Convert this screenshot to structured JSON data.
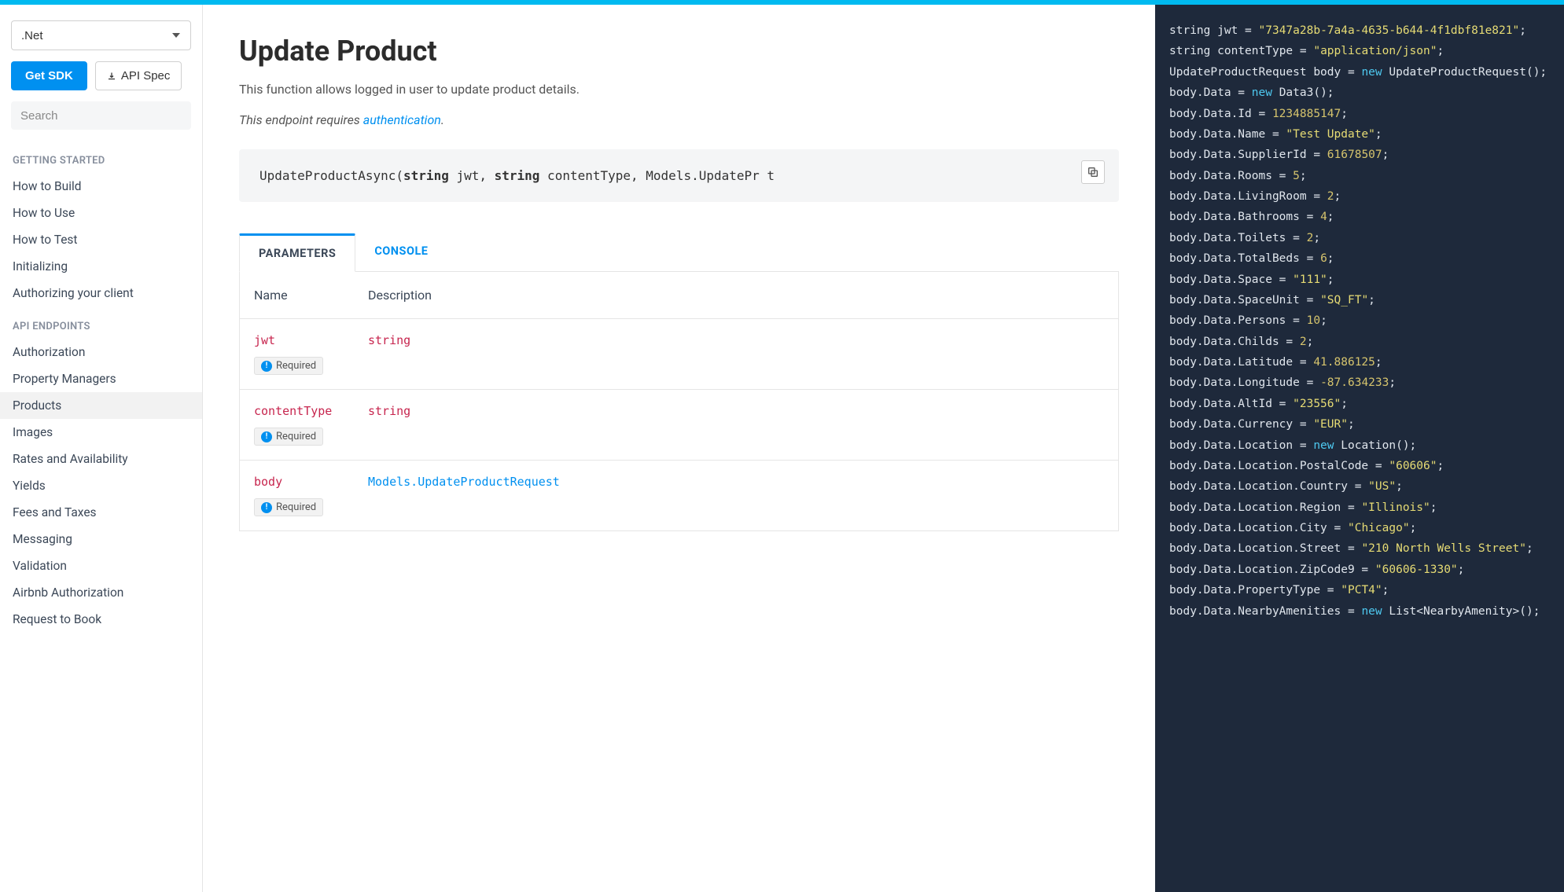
{
  "sidebar": {
    "sdk_selected": ".Net",
    "get_sdk_label": "Get SDK",
    "api_spec_label": "API Spec",
    "search_placeholder": "Search",
    "heading_getting_started": "GETTING STARTED",
    "getting_started_items": [
      "How to Build",
      "How to Use",
      "How to Test",
      "Initializing",
      "Authorizing your client"
    ],
    "heading_api_endpoints": "API ENDPOINTS",
    "api_endpoint_items": [
      "Authorization",
      "Property Managers",
      "Products",
      "Images",
      "Rates and Availability",
      "Yields",
      "Fees and Taxes",
      "Messaging",
      "Validation",
      "Airbnb Authorization",
      "Request to Book"
    ],
    "active_endpoint": "Products"
  },
  "main": {
    "title": "Update Product",
    "description": "This function allows logged in user to update product details.",
    "auth_note_prefix": "This endpoint requires ",
    "auth_note_link": "authentication",
    "auth_note_suffix": ".",
    "signature": {
      "fn": "UpdateProductAsync",
      "params_display": "UpdateProductAsync(string jwt, string contentType, Models.UpdatePr     t"
    },
    "tabs": {
      "parameters": "PARAMETERS",
      "console": "CONSOLE"
    },
    "table": {
      "col_name": "Name",
      "col_desc": "Description",
      "required_label": "Required",
      "rows": [
        {
          "name": "jwt",
          "type": "string",
          "required": true,
          "model": false
        },
        {
          "name": "contentType",
          "type": "string",
          "required": true,
          "model": false
        },
        {
          "name": "body",
          "type": "Models.UpdateProductRequest",
          "required": true,
          "model": true
        }
      ]
    }
  },
  "code": {
    "lines": [
      {
        "tokens": [
          [
            "tok-type",
            "string"
          ],
          [
            "",
            " jwt = "
          ],
          [
            "tok-str",
            "\"7347a28b-7a4a-4635-b644-4f1dbf81e821\""
          ],
          [
            "",
            ";"
          ]
        ]
      },
      {
        "tokens": [
          [
            "tok-type",
            "string"
          ],
          [
            "",
            " contentType = "
          ],
          [
            "tok-str",
            "\"application/json\""
          ],
          [
            "",
            ";"
          ]
        ]
      },
      {
        "tokens": [
          [
            "",
            "UpdateProductRequest body = "
          ],
          [
            "tok-new",
            "new"
          ],
          [
            "",
            " UpdateProductRequest();"
          ]
        ]
      },
      {
        "tokens": [
          [
            "",
            "body.Data = "
          ],
          [
            "tok-new",
            "new"
          ],
          [
            "",
            " Data3();"
          ]
        ]
      },
      {
        "tokens": [
          [
            "",
            "body.Data.Id = "
          ],
          [
            "tok-num",
            "1234885147"
          ],
          [
            "",
            ";"
          ]
        ]
      },
      {
        "tokens": [
          [
            "",
            "body.Data.Name = "
          ],
          [
            "tok-str",
            "\"Test Update\""
          ],
          [
            "",
            ";"
          ]
        ]
      },
      {
        "tokens": [
          [
            "",
            "body.Data.SupplierId = "
          ],
          [
            "tok-num",
            "61678507"
          ],
          [
            "",
            ";"
          ]
        ]
      },
      {
        "tokens": [
          [
            "",
            "body.Data.Rooms = "
          ],
          [
            "tok-num",
            "5"
          ],
          [
            "",
            ";"
          ]
        ]
      },
      {
        "tokens": [
          [
            "",
            "body.Data.LivingRoom = "
          ],
          [
            "tok-num",
            "2"
          ],
          [
            "",
            ";"
          ]
        ]
      },
      {
        "tokens": [
          [
            "",
            "body.Data.Bathrooms = "
          ],
          [
            "tok-num",
            "4"
          ],
          [
            "",
            ";"
          ]
        ]
      },
      {
        "tokens": [
          [
            "",
            "body.Data.Toilets = "
          ],
          [
            "tok-num",
            "2"
          ],
          [
            "",
            ";"
          ]
        ]
      },
      {
        "tokens": [
          [
            "",
            "body.Data.TotalBeds = "
          ],
          [
            "tok-num",
            "6"
          ],
          [
            "",
            ";"
          ]
        ]
      },
      {
        "tokens": [
          [
            "",
            "body.Data.Space = "
          ],
          [
            "tok-str",
            "\"111\""
          ],
          [
            "",
            ";"
          ]
        ]
      },
      {
        "tokens": [
          [
            "",
            "body.Data.SpaceUnit = "
          ],
          [
            "tok-str",
            "\"SQ_FT\""
          ],
          [
            "",
            ";"
          ]
        ]
      },
      {
        "tokens": [
          [
            "",
            "body.Data.Persons = "
          ],
          [
            "tok-num",
            "10"
          ],
          [
            "",
            ";"
          ]
        ]
      },
      {
        "tokens": [
          [
            "",
            "body.Data.Childs = "
          ],
          [
            "tok-num",
            "2"
          ],
          [
            "",
            ";"
          ]
        ]
      },
      {
        "tokens": [
          [
            "",
            "body.Data.Latitude = "
          ],
          [
            "tok-num",
            "41.886125"
          ],
          [
            "",
            ";"
          ]
        ]
      },
      {
        "tokens": [
          [
            "",
            "body.Data.Longitude = "
          ],
          [
            "tok-num",
            "-87.634233"
          ],
          [
            "",
            ";"
          ]
        ]
      },
      {
        "tokens": [
          [
            "",
            "body.Data.AltId = "
          ],
          [
            "tok-str",
            "\"23556\""
          ],
          [
            "",
            ";"
          ]
        ]
      },
      {
        "tokens": [
          [
            "",
            "body.Data.Currency = "
          ],
          [
            "tok-str",
            "\"EUR\""
          ],
          [
            "",
            ";"
          ]
        ]
      },
      {
        "tokens": [
          [
            "",
            "body.Data.Location = "
          ],
          [
            "tok-new",
            "new"
          ],
          [
            "",
            " Location();"
          ]
        ]
      },
      {
        "tokens": [
          [
            "",
            "body.Data.Location.PostalCode = "
          ],
          [
            "tok-str",
            "\"60606\""
          ],
          [
            "",
            ";"
          ]
        ]
      },
      {
        "tokens": [
          [
            "",
            "body.Data.Location.Country = "
          ],
          [
            "tok-str",
            "\"US\""
          ],
          [
            "",
            ";"
          ]
        ]
      },
      {
        "tokens": [
          [
            "",
            "body.Data.Location.Region = "
          ],
          [
            "tok-str",
            "\"Illinois\""
          ],
          [
            "",
            ";"
          ]
        ]
      },
      {
        "tokens": [
          [
            "",
            "body.Data.Location.City = "
          ],
          [
            "tok-str",
            "\"Chicago\""
          ],
          [
            "",
            ";"
          ]
        ]
      },
      {
        "tokens": [
          [
            "",
            "body.Data.Location.Street = "
          ],
          [
            "tok-str",
            "\"210 North Wells Street\""
          ],
          [
            "",
            ";"
          ]
        ]
      },
      {
        "tokens": [
          [
            "",
            "body.Data.Location.ZipCode9 = "
          ],
          [
            "tok-str",
            "\"60606-1330\""
          ],
          [
            "",
            ";"
          ]
        ]
      },
      {
        "tokens": [
          [
            "",
            "body.Data.PropertyType = "
          ],
          [
            "tok-str",
            "\"PCT4\""
          ],
          [
            "",
            ";"
          ]
        ]
      },
      {
        "tokens": [
          [
            "",
            "body.Data.NearbyAmenities = "
          ],
          [
            "tok-new",
            "new"
          ],
          [
            "",
            " List<NearbyAmenity>();"
          ]
        ]
      }
    ]
  }
}
